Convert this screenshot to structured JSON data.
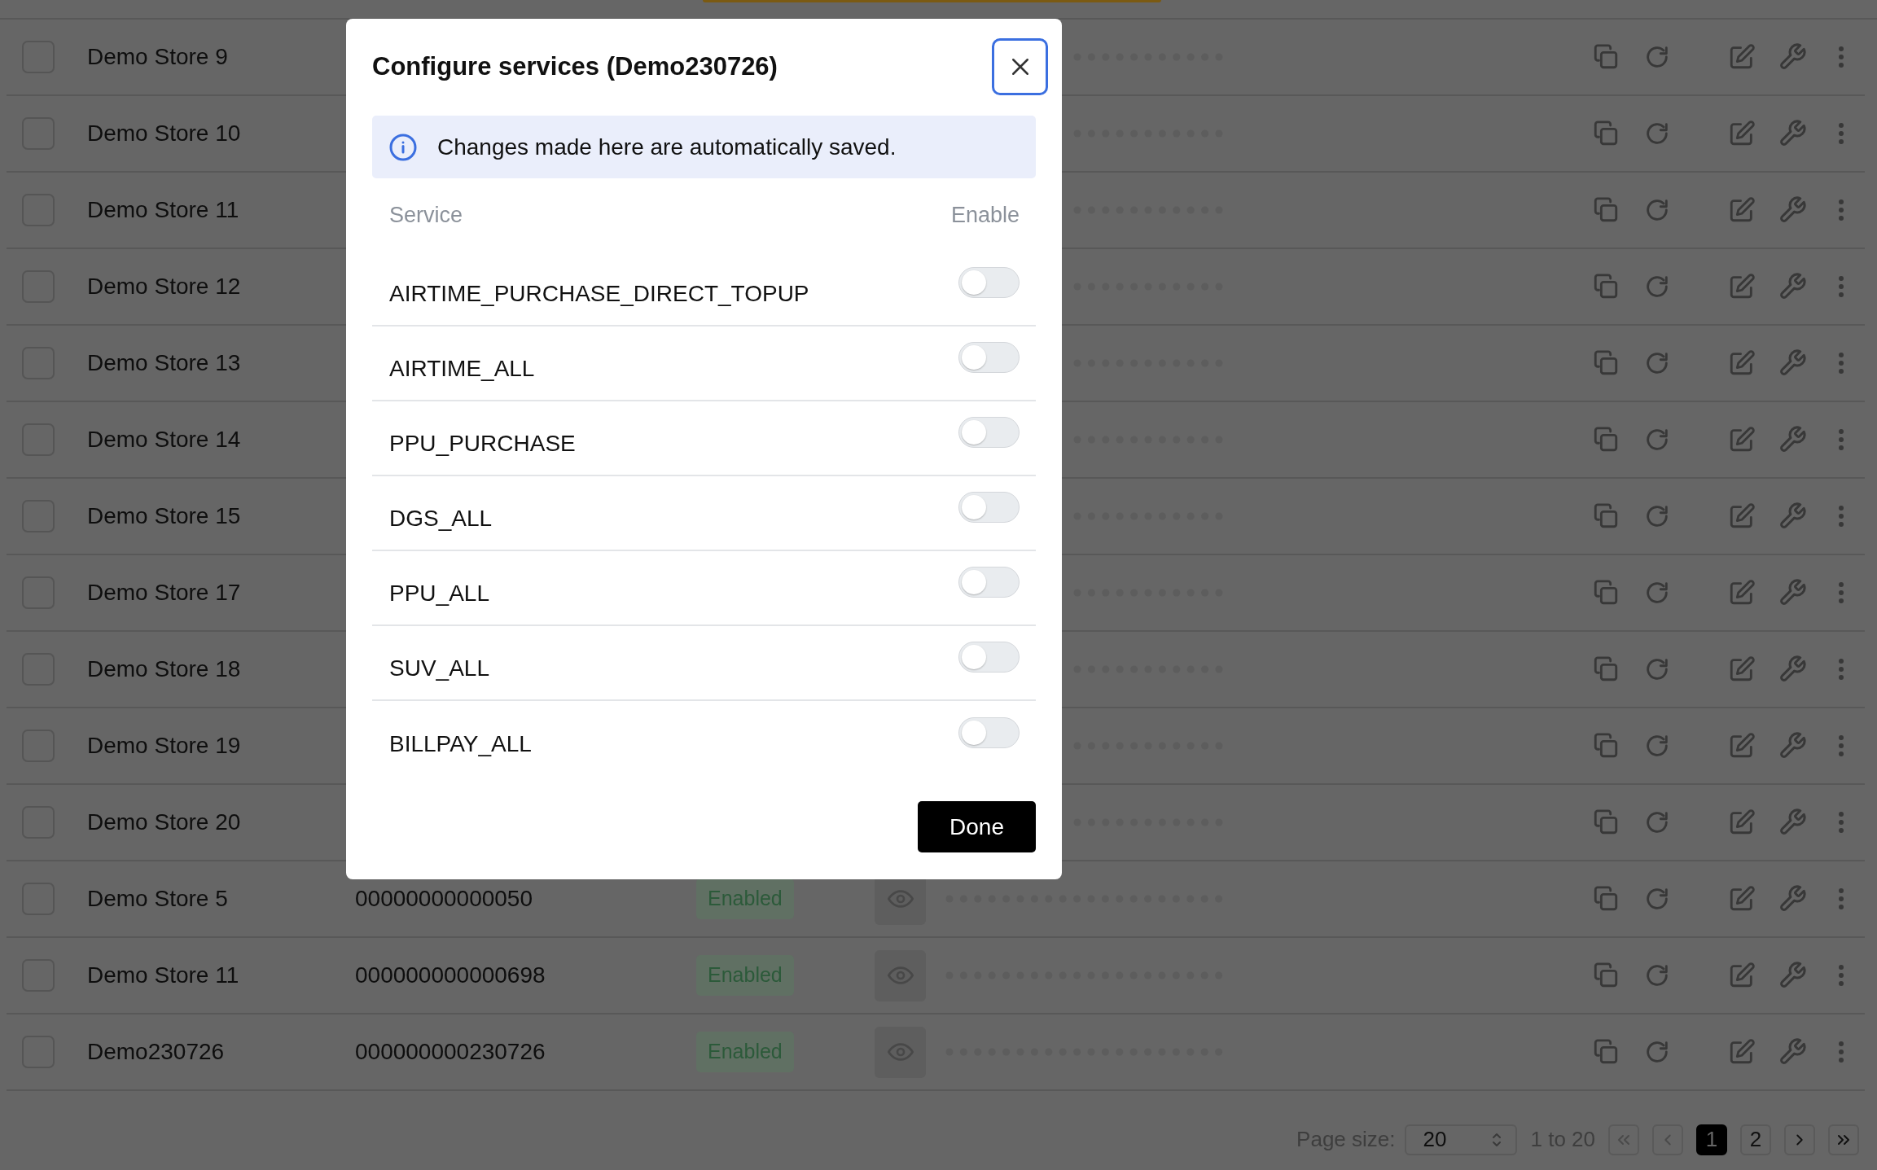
{
  "rows": [
    {
      "name": "Demo Store 9",
      "checked": false
    },
    {
      "name": "Demo Store 10",
      "checked": false
    },
    {
      "name": "Demo Store 11",
      "checked": false
    },
    {
      "name": "Demo Store 12",
      "checked": false
    },
    {
      "name": "Demo Store 13",
      "checked": false
    },
    {
      "name": "Demo Store 14",
      "checked": false
    },
    {
      "name": "Demo Store 15",
      "checked": false
    },
    {
      "name": "Demo Store 17",
      "checked": false
    },
    {
      "name": "Demo Store 18",
      "checked": false
    },
    {
      "name": "Demo Store 19",
      "checked": false
    },
    {
      "name": "Demo Store 20",
      "checked": false
    },
    {
      "name": "Demo Store 5",
      "id": "00000000000050",
      "status": "Enabled",
      "checked": false
    },
    {
      "name": "Demo Store 11",
      "id": "000000000000698",
      "status": "Enabled",
      "checked": false
    },
    {
      "name": "Demo230726",
      "id": "000000000230726",
      "status": "Enabled",
      "checked": false
    }
  ],
  "pagination": {
    "page_size_label": "Page size:",
    "page_size": "20",
    "range": "1 to 20",
    "pages": [
      {
        "label": "1",
        "selected": true
      },
      {
        "label": "2",
        "selected": false
      }
    ]
  },
  "modal": {
    "title": "Configure services (Demo230726)",
    "info": "Changes made here are automatically saved.",
    "columns": [
      "Service",
      "Enable"
    ],
    "services": [
      {
        "name": "AIRTIME_PURCHASE_DIRECT_TOPUP",
        "on": false
      },
      {
        "name": "AIRTIME_ALL",
        "on": false
      },
      {
        "name": "PPU_PURCHASE",
        "on": false
      },
      {
        "name": "DGS_ALL",
        "on": false
      },
      {
        "name": "PPU_ALL",
        "on": false
      },
      {
        "name": "SUV_ALL",
        "on": false
      },
      {
        "name": "BILLPAY_ALL",
        "on": false
      }
    ],
    "done": "Done"
  }
}
